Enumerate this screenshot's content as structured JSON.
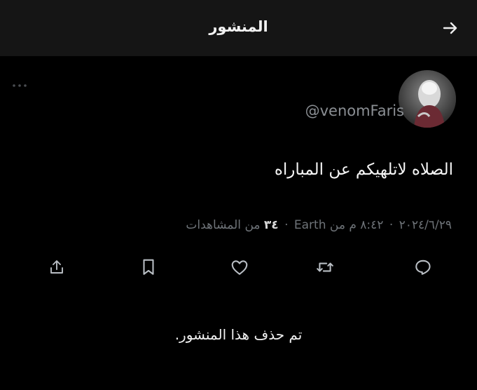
{
  "header": {
    "title": "المنشور",
    "back_icon": "arrow-right-icon",
    "background": "#151515"
  },
  "tweet": {
    "handle": "@venomFaris",
    "text": "الصلاه لاتلهيكم عن المباراه",
    "meta": {
      "date": "٢٠٢٤/٦/٢٩",
      "time": "٨:٤٢ م من Earth",
      "views_count": "٣٤",
      "views_label": "من المشاهدات",
      "separator": "·"
    },
    "more_icon": "more-horizontal-icon"
  },
  "actions": [
    {
      "name": "reply",
      "icon": "reply-icon"
    },
    {
      "name": "retweet",
      "icon": "retweet-icon"
    },
    {
      "name": "like",
      "icon": "heart-icon"
    },
    {
      "name": "bookmark",
      "icon": "bookmark-icon"
    },
    {
      "name": "share",
      "icon": "share-icon"
    }
  ],
  "deleted_notice": "تم حذف هذا المنشور.",
  "colors": {
    "background": "#000000",
    "text": "#f5f5f5",
    "muted": "#6e7378",
    "icon": "#b9bec4"
  }
}
